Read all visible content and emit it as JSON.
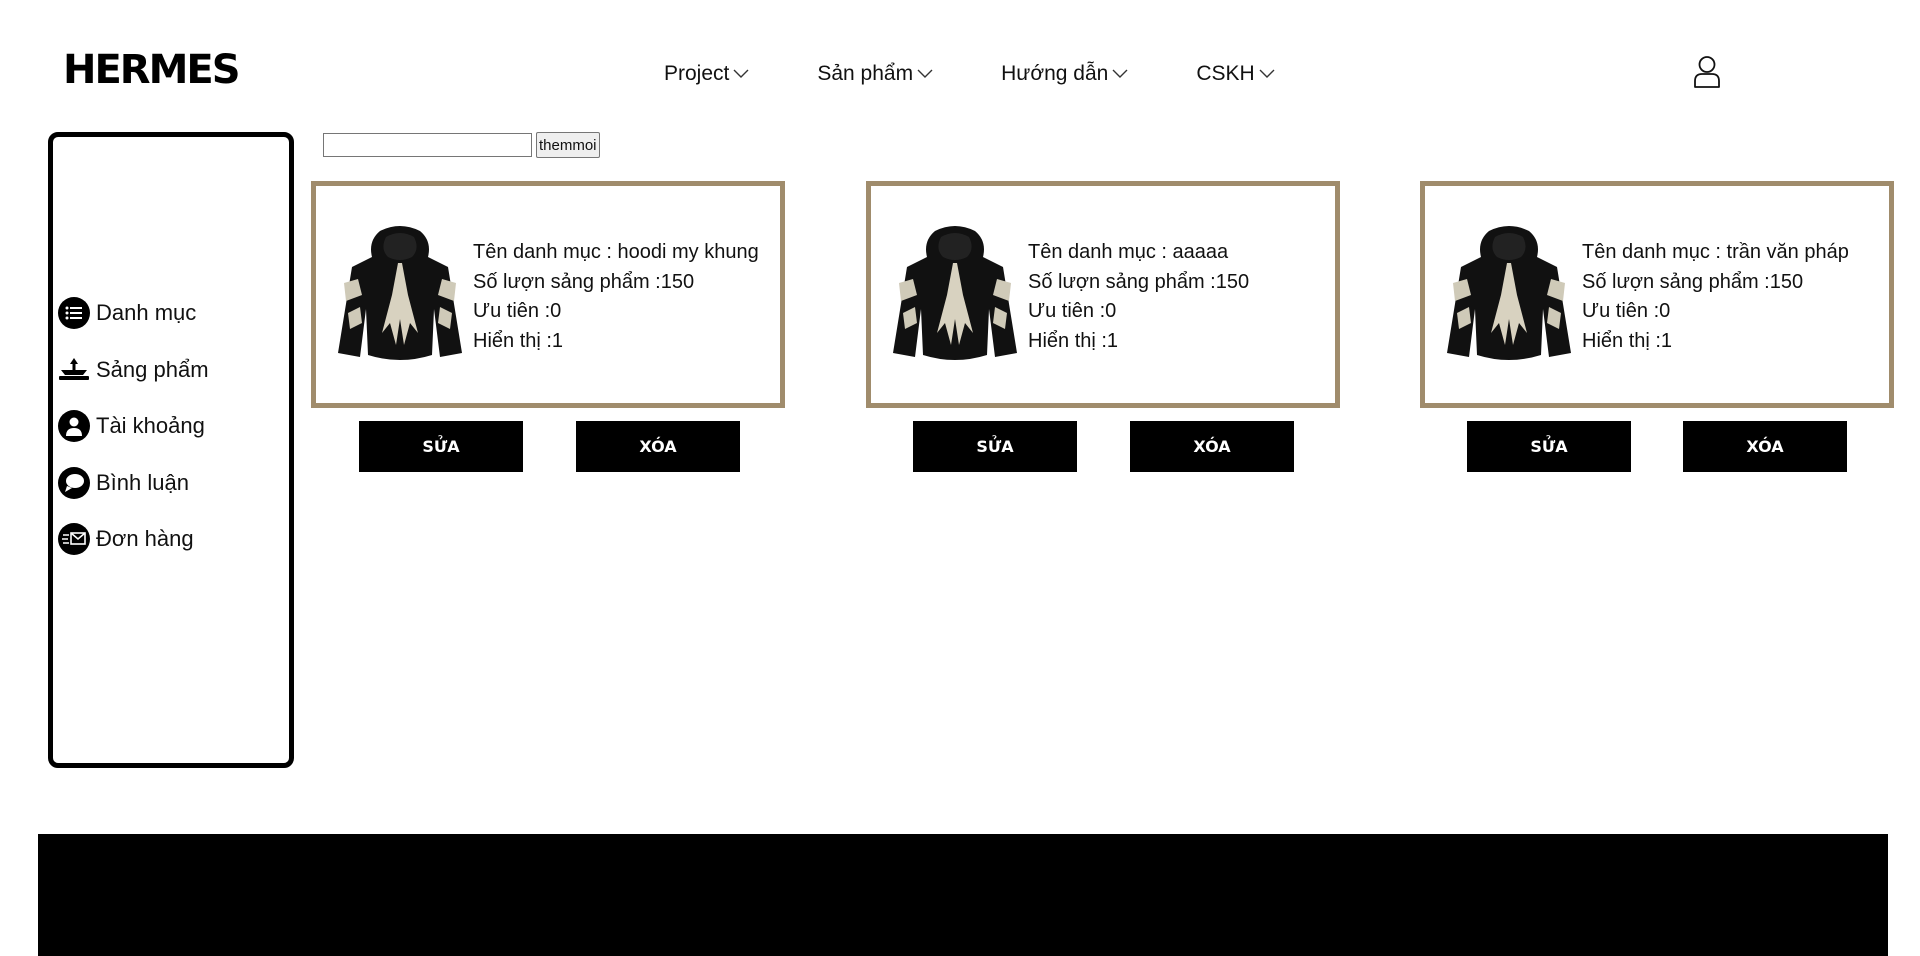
{
  "brand": "HERMES",
  "nav": [
    {
      "label": "Project"
    },
    {
      "label": "Sản phẩm"
    },
    {
      "label": "Hướng dẫn"
    },
    {
      "label": "CSKH"
    }
  ],
  "sidebar": {
    "items": [
      {
        "label": "Danh mục",
        "icon": "list-icon"
      },
      {
        "label": "Sảng phẩm",
        "icon": "product-icon"
      },
      {
        "label": "Tài khoảng",
        "icon": "user-icon"
      },
      {
        "label": "Bình luận",
        "icon": "comment-icon"
      },
      {
        "label": "Đơn hàng",
        "icon": "mail-icon"
      }
    ]
  },
  "search": {
    "value": "",
    "button_label": "themmoi"
  },
  "cards": [
    {
      "name": "Tên danh mục : hoodi my khung",
      "quantity": "Số lượn sảng phẩm :150",
      "priority": "Ưu tiên :0",
      "display": "Hiển thị :1",
      "edit_label": "SỬA",
      "delete_label": "XÓA"
    },
    {
      "name": "Tên danh mục : aaaaa",
      "quantity": "Số lượn sảng phẩm :150",
      "priority": "Ưu tiên :0",
      "display": "Hiển thị :1",
      "edit_label": "SỬA",
      "delete_label": "XÓA"
    },
    {
      "name": "Tên danh mục : trần văn pháp",
      "quantity": "Số lượn sảng phẩm :150",
      "priority": "Ưu tiên :0",
      "display": "Hiển thị :1",
      "edit_label": "SỬA",
      "delete_label": "XÓA"
    }
  ],
  "colors": {
    "card_border": "#a08c6c",
    "button_bg": "#000000",
    "footer_bg": "#000000"
  }
}
